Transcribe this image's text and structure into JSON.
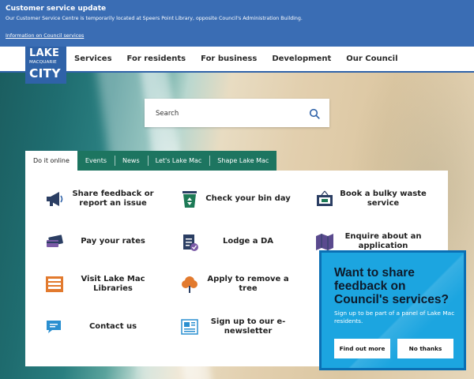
{
  "alert": {
    "title": "Customer service update",
    "message": "Our Customer Service Centre is temporarily located at Speers Point Library, opposite Council's Administration Building.",
    "link": "Information on Council services"
  },
  "logo": {
    "line1": "LAKE",
    "line2": "MACQUARIE",
    "line3": "CITY"
  },
  "nav": [
    "Services",
    "For residents",
    "For business",
    "Development",
    "Our Council"
  ],
  "search": {
    "placeholder": "Search",
    "icon": "search-icon"
  },
  "tabs": [
    "Do it online",
    "Events",
    "News",
    "Let's Lake Mac",
    "Shape Lake Mac"
  ],
  "active_tab": "Do it online",
  "services": [
    {
      "label": "Share feedback or report an issue",
      "icon": "megaphone-icon"
    },
    {
      "label": "Check your bin day",
      "icon": "recycle-bin-icon"
    },
    {
      "label": "Book a bulky waste service",
      "icon": "couch-icon"
    },
    {
      "label": "Pay your rates",
      "icon": "credit-card-icon"
    },
    {
      "label": "Lodge a DA",
      "icon": "clipboard-check-icon"
    },
    {
      "label": "Enquire about an application",
      "icon": "map-icon"
    },
    {
      "label": "Visit Lake Mac Libraries",
      "icon": "bookshelf-icon"
    },
    {
      "label": "Apply to remove a tree",
      "icon": "tree-icon"
    },
    {
      "label": "Contact us",
      "icon": "chat-bubble-icon"
    },
    {
      "label": "Sign up to our e-newsletter",
      "icon": "newspaper-icon"
    }
  ],
  "popup": {
    "heading": "Want to share feedback on Council's services?",
    "text": "Sign up to be part of a panel of Lake Mac residents.",
    "primary_button": "Find out more",
    "secondary_button": "No thanks"
  },
  "colors": {
    "brand_blue": "#2f62a8",
    "tab_green": "#1d7560",
    "popup_blue": "#1ca5e0"
  }
}
